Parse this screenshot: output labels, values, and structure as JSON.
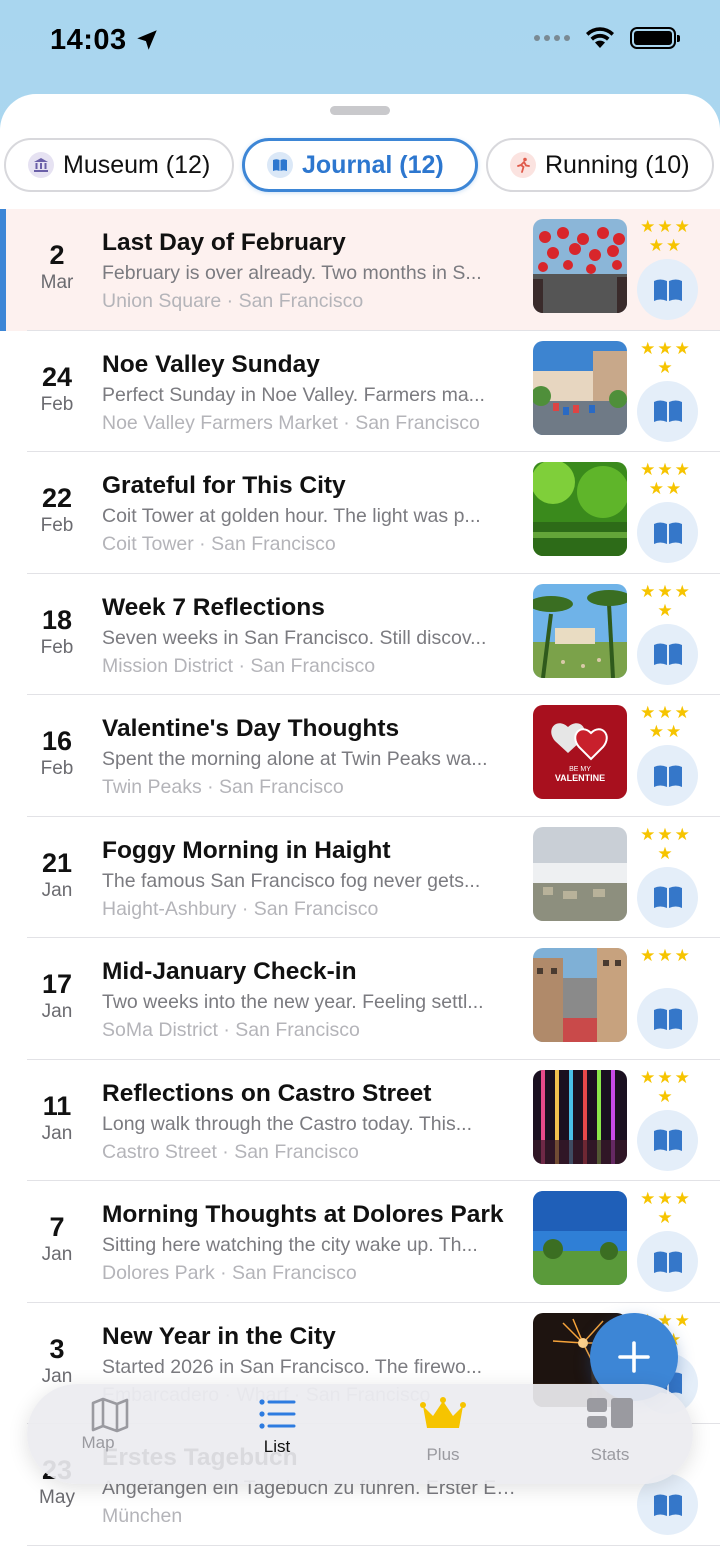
{
  "status_bar": {
    "time": "14:03"
  },
  "filters": [
    {
      "label": "Museum (12)"
    },
    {
      "label": "Journal (12)"
    },
    {
      "label": "Running (10)"
    }
  ],
  "entries": [
    {
      "day": "2",
      "month": "Mar",
      "title": "Last Day of February",
      "snippet": "February is over already. Two months in S...",
      "place": "Union Square · San Francisco",
      "stars": "★★★\n★★"
    },
    {
      "day": "24",
      "month": "Feb",
      "title": "Noe Valley Sunday",
      "snippet": "Perfect Sunday in Noe Valley. Farmers ma...",
      "place": "Noe Valley Farmers Market · San Francisco",
      "stars": "★★★\n★"
    },
    {
      "day": "22",
      "month": "Feb",
      "title": "Grateful for This City",
      "snippet": "Coit Tower at golden hour. The light was p...",
      "place": "Coit Tower · San Francisco",
      "stars": "★★★\n★★"
    },
    {
      "day": "18",
      "month": "Feb",
      "title": "Week 7 Reflections",
      "snippet": "Seven weeks in San Francisco. Still discov...",
      "place": "Mission District · San Francisco",
      "stars": "★★★\n★"
    },
    {
      "day": "16",
      "month": "Feb",
      "title": "Valentine's Day Thoughts",
      "snippet": "Spent the morning alone at Twin Peaks wa...",
      "place": "Twin Peaks · San Francisco",
      "stars": "★★★\n★★"
    },
    {
      "day": "21",
      "month": "Jan",
      "title": "Foggy Morning in Haight",
      "snippet": "The famous San Francisco fog never gets...",
      "place": "Haight-Ashbury · San Francisco",
      "stars": "★★★\n★"
    },
    {
      "day": "17",
      "month": "Jan",
      "title": "Mid-January Check-in",
      "snippet": "Two weeks into the new year. Feeling settl...",
      "place": "SoMa District · San Francisco",
      "stars": "★★★"
    },
    {
      "day": "11",
      "month": "Jan",
      "title": "Reflections on Castro Street",
      "snippet": "Long walk through the Castro today. This...",
      "place": "Castro Street · San Francisco",
      "stars": "★★★\n★"
    },
    {
      "day": "7",
      "month": "Jan",
      "title": "Morning Thoughts at Dolores Park",
      "snippet": "Sitting here watching the city wake up. Th...",
      "place": "Dolores Park · San Francisco",
      "stars": "★★★\n★"
    },
    {
      "day": "3",
      "month": "Jan",
      "title": "New Year in the City",
      "snippet": "Started 2026 in San Francisco. The firewo...",
      "place": "Embarcadero · Wharf · San Francisco",
      "stars": "★★★\n★★"
    },
    {
      "day": "23",
      "month": "May",
      "title": "Erstes Tagebuch",
      "snippet": "Angefangen ein Tagebuch zu führen. Erster Eintrag:...",
      "place": "München",
      "stars": ""
    }
  ],
  "valentine_text": {
    "line1": "BE MY",
    "line2": "VALENTINE"
  },
  "tabs": [
    {
      "label": "Map"
    },
    {
      "label": "List"
    },
    {
      "label": "Plus"
    },
    {
      "label": "Stats"
    }
  ],
  "colors": {
    "accent": "#3d86d6",
    "star": "#f6c400",
    "crown": "#f6c400",
    "selected_row": "#fdf1ef"
  }
}
